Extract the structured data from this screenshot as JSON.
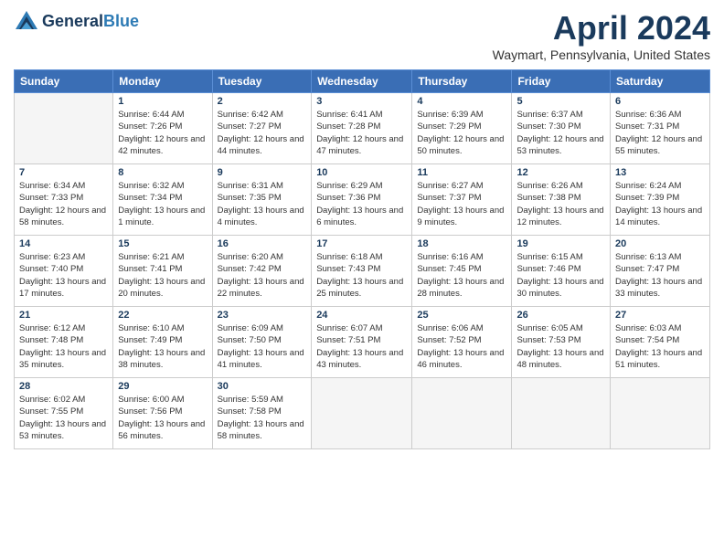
{
  "header": {
    "logo_line1": "General",
    "logo_line2": "Blue",
    "month_title": "April 2024",
    "location": "Waymart, Pennsylvania, United States"
  },
  "calendar": {
    "days_of_week": [
      "Sunday",
      "Monday",
      "Tuesday",
      "Wednesday",
      "Thursday",
      "Friday",
      "Saturday"
    ],
    "weeks": [
      [
        {
          "day": "",
          "empty": true
        },
        {
          "day": "1",
          "sunrise": "6:44 AM",
          "sunset": "7:26 PM",
          "daylight": "12 hours and 42 minutes."
        },
        {
          "day": "2",
          "sunrise": "6:42 AM",
          "sunset": "7:27 PM",
          "daylight": "12 hours and 44 minutes."
        },
        {
          "day": "3",
          "sunrise": "6:41 AM",
          "sunset": "7:28 PM",
          "daylight": "12 hours and 47 minutes."
        },
        {
          "day": "4",
          "sunrise": "6:39 AM",
          "sunset": "7:29 PM",
          "daylight": "12 hours and 50 minutes."
        },
        {
          "day": "5",
          "sunrise": "6:37 AM",
          "sunset": "7:30 PM",
          "daylight": "12 hours and 53 minutes."
        },
        {
          "day": "6",
          "sunrise": "6:36 AM",
          "sunset": "7:31 PM",
          "daylight": "12 hours and 55 minutes."
        }
      ],
      [
        {
          "day": "7",
          "sunrise": "6:34 AM",
          "sunset": "7:33 PM",
          "daylight": "12 hours and 58 minutes."
        },
        {
          "day": "8",
          "sunrise": "6:32 AM",
          "sunset": "7:34 PM",
          "daylight": "13 hours and 1 minute."
        },
        {
          "day": "9",
          "sunrise": "6:31 AM",
          "sunset": "7:35 PM",
          "daylight": "13 hours and 4 minutes."
        },
        {
          "day": "10",
          "sunrise": "6:29 AM",
          "sunset": "7:36 PM",
          "daylight": "13 hours and 6 minutes."
        },
        {
          "day": "11",
          "sunrise": "6:27 AM",
          "sunset": "7:37 PM",
          "daylight": "13 hours and 9 minutes."
        },
        {
          "day": "12",
          "sunrise": "6:26 AM",
          "sunset": "7:38 PM",
          "daylight": "13 hours and 12 minutes."
        },
        {
          "day": "13",
          "sunrise": "6:24 AM",
          "sunset": "7:39 PM",
          "daylight": "13 hours and 14 minutes."
        }
      ],
      [
        {
          "day": "14",
          "sunrise": "6:23 AM",
          "sunset": "7:40 PM",
          "daylight": "13 hours and 17 minutes."
        },
        {
          "day": "15",
          "sunrise": "6:21 AM",
          "sunset": "7:41 PM",
          "daylight": "13 hours and 20 minutes."
        },
        {
          "day": "16",
          "sunrise": "6:20 AM",
          "sunset": "7:42 PM",
          "daylight": "13 hours and 22 minutes."
        },
        {
          "day": "17",
          "sunrise": "6:18 AM",
          "sunset": "7:43 PM",
          "daylight": "13 hours and 25 minutes."
        },
        {
          "day": "18",
          "sunrise": "6:16 AM",
          "sunset": "7:45 PM",
          "daylight": "13 hours and 28 minutes."
        },
        {
          "day": "19",
          "sunrise": "6:15 AM",
          "sunset": "7:46 PM",
          "daylight": "13 hours and 30 minutes."
        },
        {
          "day": "20",
          "sunrise": "6:13 AM",
          "sunset": "7:47 PM",
          "daylight": "13 hours and 33 minutes."
        }
      ],
      [
        {
          "day": "21",
          "sunrise": "6:12 AM",
          "sunset": "7:48 PM",
          "daylight": "13 hours and 35 minutes."
        },
        {
          "day": "22",
          "sunrise": "6:10 AM",
          "sunset": "7:49 PM",
          "daylight": "13 hours and 38 minutes."
        },
        {
          "day": "23",
          "sunrise": "6:09 AM",
          "sunset": "7:50 PM",
          "daylight": "13 hours and 41 minutes."
        },
        {
          "day": "24",
          "sunrise": "6:07 AM",
          "sunset": "7:51 PM",
          "daylight": "13 hours and 43 minutes."
        },
        {
          "day": "25",
          "sunrise": "6:06 AM",
          "sunset": "7:52 PM",
          "daylight": "13 hours and 46 minutes."
        },
        {
          "day": "26",
          "sunrise": "6:05 AM",
          "sunset": "7:53 PM",
          "daylight": "13 hours and 48 minutes."
        },
        {
          "day": "27",
          "sunrise": "6:03 AM",
          "sunset": "7:54 PM",
          "daylight": "13 hours and 51 minutes."
        }
      ],
      [
        {
          "day": "28",
          "sunrise": "6:02 AM",
          "sunset": "7:55 PM",
          "daylight": "13 hours and 53 minutes."
        },
        {
          "day": "29",
          "sunrise": "6:00 AM",
          "sunset": "7:56 PM",
          "daylight": "13 hours and 56 minutes."
        },
        {
          "day": "30",
          "sunrise": "5:59 AM",
          "sunset": "7:58 PM",
          "daylight": "13 hours and 58 minutes."
        },
        {
          "day": "",
          "empty": true
        },
        {
          "day": "",
          "empty": true
        },
        {
          "day": "",
          "empty": true
        },
        {
          "day": "",
          "empty": true
        }
      ]
    ]
  }
}
